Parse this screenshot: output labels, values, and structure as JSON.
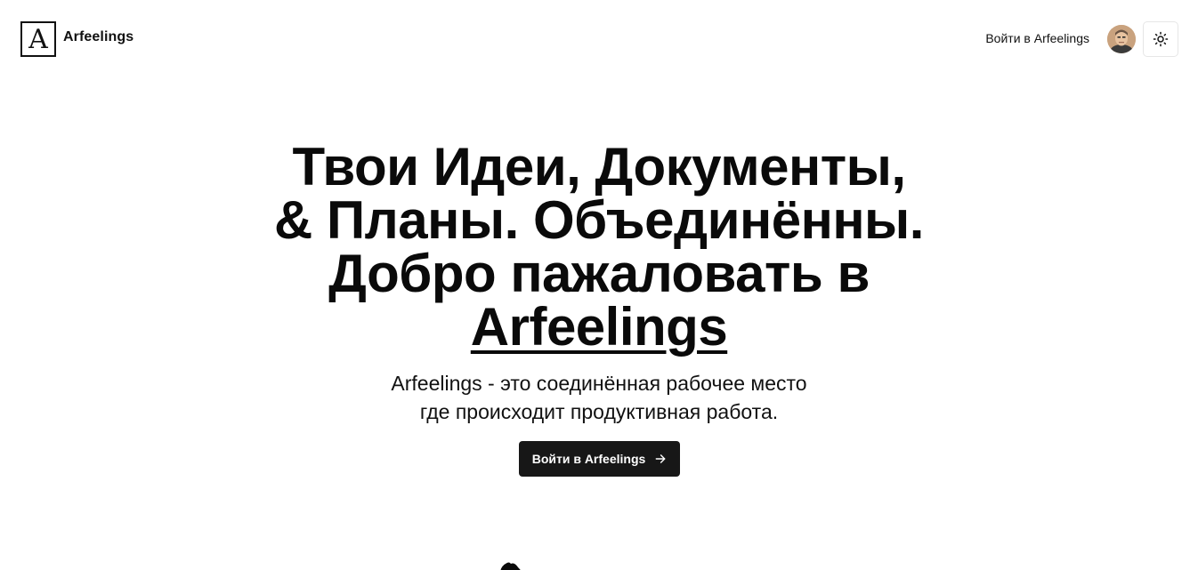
{
  "header": {
    "logo_letter": "A",
    "brand_name": "Arfeelings",
    "nav_login": "Войти в Arfeelings",
    "theme_toggle_icon": "sun-icon",
    "avatar_icon": "avatar"
  },
  "hero": {
    "title_lines": [
      "Твои Идеи, Документы,",
      "& Планы. Объединённы.",
      "Добро пажаловать в"
    ],
    "title_brand": "Arfeelings",
    "subtitle_lines": [
      "Arfeelings - это соединённая рабочее место",
      "где происходит продуктивная работа."
    ],
    "cta_label": "Войти в Arfeelings",
    "cta_icon": "arrow-right-icon"
  },
  "colors": {
    "text": "#0a0a0a",
    "button_bg": "#171717",
    "button_text": "#ffffff",
    "border": "#e6e6e6"
  }
}
